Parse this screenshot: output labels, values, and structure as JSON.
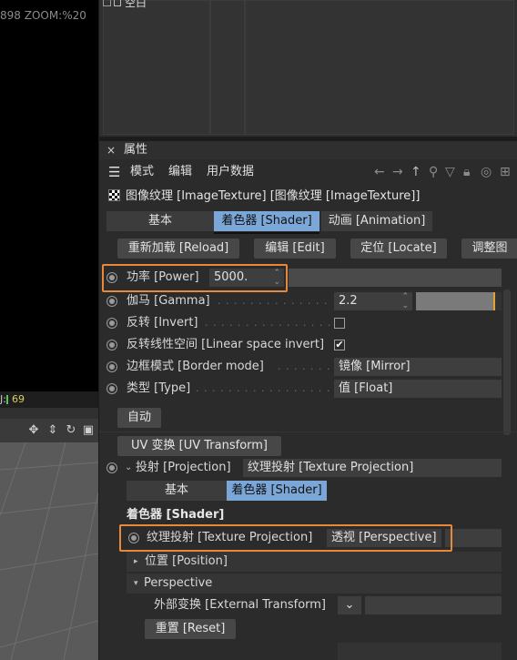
{
  "viewport": {
    "stats_text": "898 ZOOM:%20",
    "status_value": "69",
    "status_prefix": "J:"
  },
  "outliner": {
    "empty_label": "空白"
  },
  "panel": {
    "title": "属性",
    "close": "×",
    "menu": [
      "模式",
      "编辑",
      "用户数据"
    ],
    "nav_icons": [
      "←",
      "→",
      "↑"
    ]
  },
  "texture_title": "图像纹理 [ImageTexture] [图像纹理 [ImageTexture]]",
  "tabs": [
    "基本",
    "着色器 [Shader]",
    "动画 [Animation]"
  ],
  "buttons": [
    "重新加载 [Reload]",
    "编辑 [Edit]",
    "定位 [Locate]",
    "调整图"
  ],
  "params": {
    "power_label": "功率 [Power]",
    "power_value": "5000.",
    "gamma_label": "伽马 [Gamma]",
    "gamma_value": "2.2",
    "gamma_fraction": 0.93,
    "invert_label": "反转 [Invert]",
    "invert_checked": false,
    "linear_label": "反转线性空间 [Linear space invert]",
    "linear_checked": true,
    "border_label": "边框模式 [Border mode]",
    "border_value": "镜像 [Mirror]",
    "type_label": "类型 [Type]",
    "type_value": "值 [Float]"
  },
  "auto_button": "自动",
  "uv_button": "UV 变换 [UV Transform]",
  "projection": {
    "label": "投射 [Projection]",
    "value": "纹理投射 [Texture Projection]",
    "tabs": [
      "基本",
      "着色器 [Shader]"
    ],
    "section_header": "着色器 [Shader]",
    "tex_proj_label": "纹理投射 [Texture Projection]",
    "tex_proj_value": "透视 [Perspective]",
    "position_label": "位置 [Position]",
    "perspective_label": "Perspective",
    "external_label": "外部变换 [External Transform]",
    "reset_button": "重置 [Reset]"
  },
  "colors": {
    "highlight": "#e8883a",
    "tab_active": "#7aa7d8",
    "gamma_marker": "#e8a030"
  }
}
